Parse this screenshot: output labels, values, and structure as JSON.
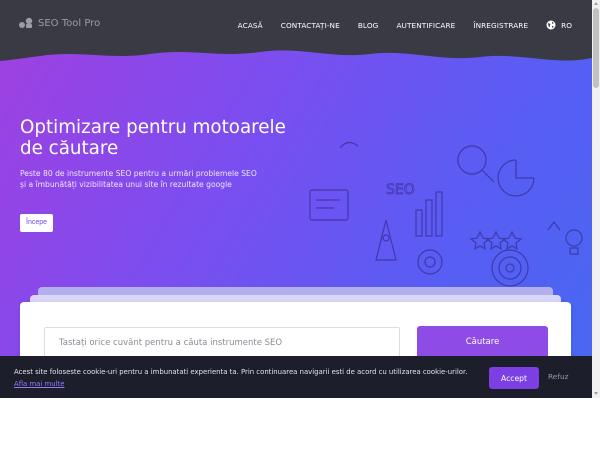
{
  "brand": {
    "name": "SEO Tool Pro",
    "icon": "tools-logo-icon"
  },
  "nav": {
    "items": [
      {
        "label": "ACASĂ"
      },
      {
        "label": "CONTACTAȚI-NE"
      },
      {
        "label": "BLOG"
      },
      {
        "label": "AUTENTIFICARE"
      },
      {
        "label": "ÎNREGISTRARE"
      }
    ],
    "language": {
      "label": "RO",
      "icon": "globe-icon"
    }
  },
  "hero": {
    "title": "Optimizare pentru motoarele de căutare",
    "subtitle": "Peste 80 de instrumente SEO pentru a urmări problemele SEO",
    "subtitle2": "și a îmbunătăți vizibilitatea unui site în rezultate google",
    "start_label": "Începe"
  },
  "search": {
    "placeholder": "Tastați orice cuvânt pentru a căuta instrumente SEO",
    "button_label": "Căutare"
  },
  "cookie": {
    "text": "Acest site foloseste cookie-uri pentru a imbunatati experienta ta. Prin continuarea navigarii esti de acord cu utilizarea cookie-urilor.",
    "link_label": "Afla mai multe",
    "accept_label": "Accept",
    "refuse_label": "Refuz"
  },
  "colors": {
    "nav_bg": "#3a3a44",
    "hero_gradient_start": "#a23fe0",
    "hero_gradient_end": "#4768f2",
    "accent": "#8f4be6",
    "cookie_bg": "#1d1e2c"
  }
}
